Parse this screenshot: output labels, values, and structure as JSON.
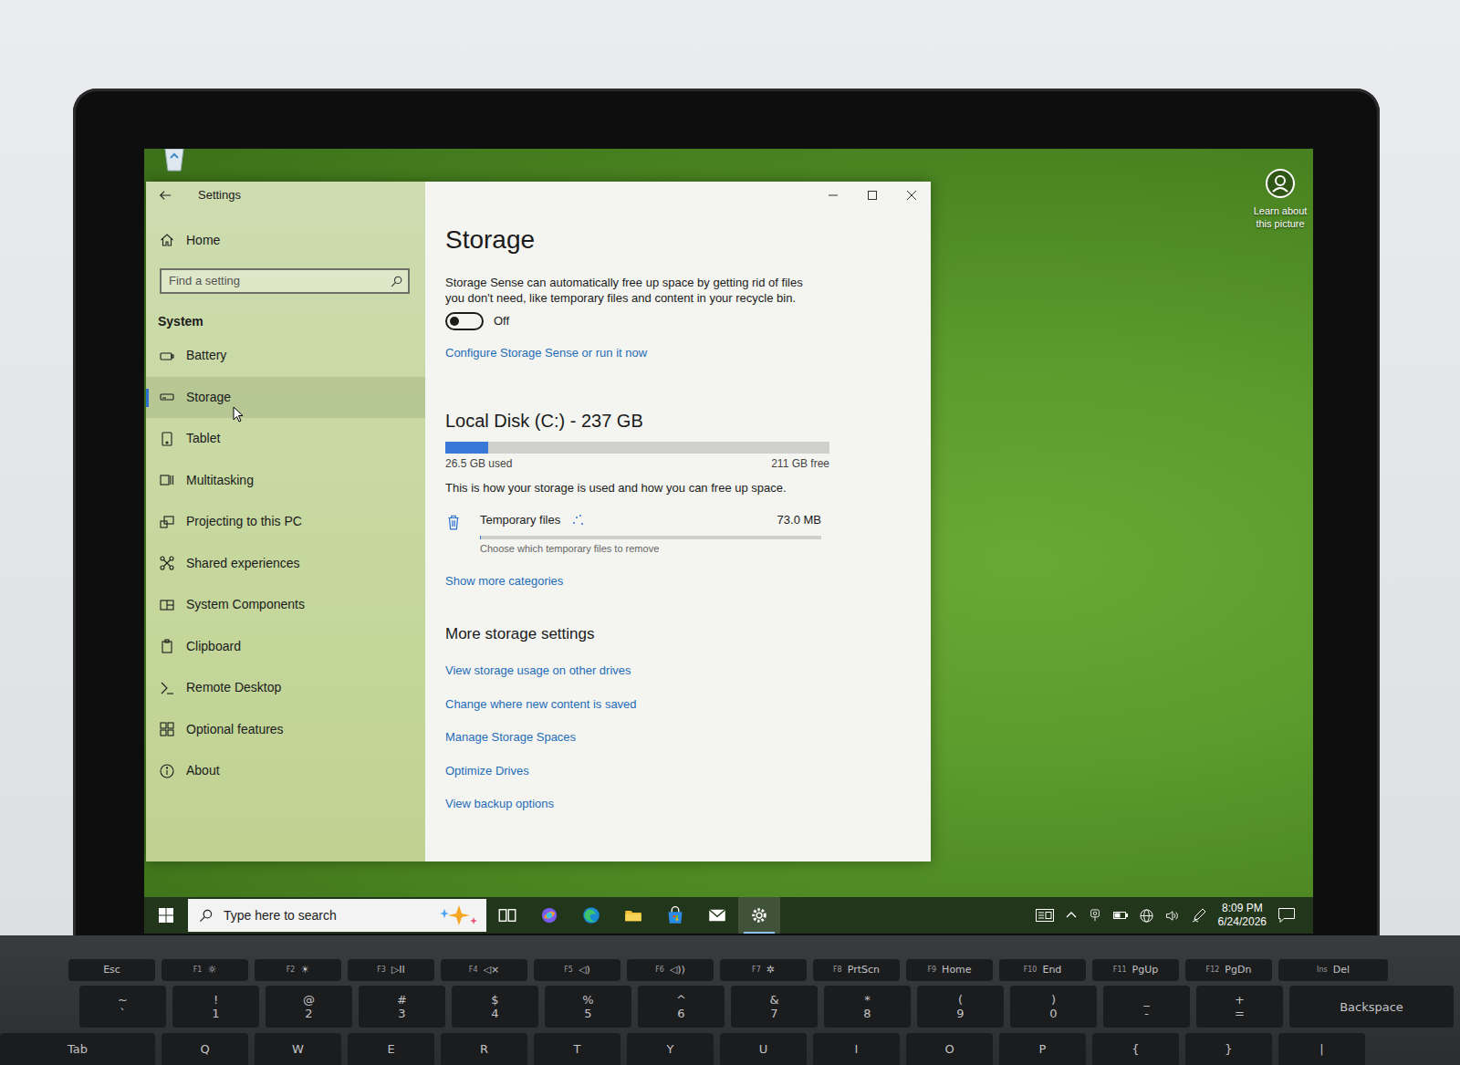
{
  "desktop": {
    "spotlight": "Learn about this picture"
  },
  "window": {
    "title": "Settings"
  },
  "sidebar": {
    "home": "Home",
    "search": {
      "placeholder": "Find a setting"
    },
    "section": "System",
    "items": [
      {
        "label": "Battery",
        "selected": false
      },
      {
        "label": "Storage",
        "selected": true
      },
      {
        "label": "Tablet",
        "selected": false
      },
      {
        "label": "Multitasking",
        "selected": false
      },
      {
        "label": "Projecting to this PC",
        "selected": false
      },
      {
        "label": "Shared experiences",
        "selected": false
      },
      {
        "label": "System Components",
        "selected": false
      },
      {
        "label": "Clipboard",
        "selected": false
      },
      {
        "label": "Remote Desktop",
        "selected": false
      },
      {
        "label": "Optional features",
        "selected": false
      },
      {
        "label": "About",
        "selected": false
      }
    ]
  },
  "storage": {
    "title": "Storage",
    "description": "Storage Sense can automatically free up space by getting rid of files you don't need, like temporary files and content in your recycle bin.",
    "storage_sense": {
      "on": false,
      "label": "Off"
    },
    "configure_link": "Configure Storage Sense or run it now",
    "disk": {
      "title": "Local Disk (C:) - 237 GB",
      "level": 0.112,
      "used": "26.5 GB used",
      "free": "211 GB free",
      "caption": "This is how your storage is used and how you can free up space."
    },
    "categories": [
      {
        "label": "Temporary files",
        "size": "73.0 MB",
        "detail": "Choose which temporary files to remove",
        "level": 0.003,
        "loading": true
      }
    ],
    "show_more": "Show more categories",
    "more_title": "More storage settings",
    "more_links": [
      "View storage usage on other drives",
      "Change where new content is saved",
      "Manage Storage Spaces",
      "Optimize Drives",
      "View backup options"
    ]
  },
  "taskbar": {
    "search": "Type here to search",
    "time": "8:09 PM",
    "date": "6/24/2026",
    "apps": [
      {
        "selected": false
      },
      {
        "selected": false
      },
      {
        "selected": false
      },
      {
        "selected": false
      },
      {
        "selected": false
      },
      {
        "selected": false
      },
      {
        "selected": true
      }
    ]
  },
  "keyboard": {
    "rows": [
      {
        "kind": "function",
        "keys": [
          {
            "main": "Esc",
            "sub": ""
          },
          {
            "main": "☼",
            "sub": "F1"
          },
          {
            "main": "☀",
            "sub": "F2"
          },
          {
            "main": "▷II",
            "sub": "F3"
          },
          {
            "main": "◁×",
            "sub": "F4"
          },
          {
            "main": "◁)",
            "sub": "F5"
          },
          {
            "main": "◁))",
            "sub": "F6"
          },
          {
            "main": "✲",
            "sub": "F7"
          },
          {
            "main": "PrtScn",
            "sub": "F8"
          },
          {
            "main": "Home",
            "sub": "F9"
          },
          {
            "main": "End",
            "sub": "F10"
          },
          {
            "main": "PgUp",
            "sub": "F11"
          },
          {
            "main": "PgDn",
            "sub": "F12"
          },
          {
            "main": "Del",
            "sub": "Ins"
          }
        ]
      },
      {
        "kind": "number",
        "keys": [
          {
            "main": "`",
            "sub": "~"
          },
          {
            "main": "1",
            "sub": "!"
          },
          {
            "main": "2",
            "sub": "@"
          },
          {
            "main": "3",
            "sub": "#"
          },
          {
            "main": "4",
            "sub": "$"
          },
          {
            "main": "5",
            "sub": "%"
          },
          {
            "main": "6",
            "sub": "^"
          },
          {
            "main": "7",
            "sub": "&"
          },
          {
            "main": "8",
            "sub": "*"
          },
          {
            "main": "9",
            "sub": "("
          },
          {
            "main": "0",
            "sub": ")"
          },
          {
            "main": "-",
            "sub": "_"
          },
          {
            "main": "=",
            "sub": "+"
          },
          {
            "main": "Backspace",
            "sub": ""
          }
        ]
      },
      {
        "kind": "letter",
        "keys": [
          {
            "main": "Tab",
            "sub": ""
          },
          {
            "main": "Q",
            "sub": ""
          },
          {
            "main": "W",
            "sub": ""
          },
          {
            "main": "E",
            "sub": ""
          },
          {
            "main": "R",
            "sub": ""
          },
          {
            "main": "T",
            "sub": ""
          },
          {
            "main": "Y",
            "sub": ""
          },
          {
            "main": "U",
            "sub": ""
          },
          {
            "main": "I",
            "sub": ""
          },
          {
            "main": "O",
            "sub": ""
          },
          {
            "main": "P",
            "sub": ""
          },
          {
            "main": "{",
            "sub": ""
          },
          {
            "main": "}",
            "sub": ""
          },
          {
            "main": "|",
            "sub": ""
          }
        ]
      }
    ]
  }
}
